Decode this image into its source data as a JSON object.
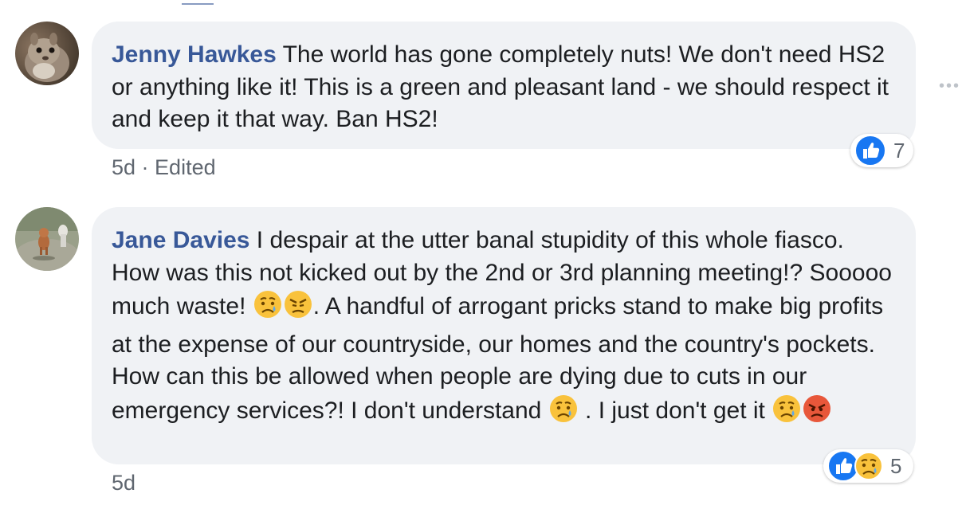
{
  "comments": [
    {
      "author": "Jenny Hawkes",
      "text": " The world has gone completely nuts! We don't need HS2 or anything like it! This is a green and pleasant land - we should respect it and keep it that way. Ban HS2!",
      "time": "5d",
      "separator": " · ",
      "edited": "Edited",
      "reaction_icons": [
        "like-icon"
      ],
      "reaction_count": "7",
      "avatar_icon": "squirrel-avatar"
    },
    {
      "author": "Jane Davies",
      "text_parts": [
        " I despair at the utter banal stupidity of this whole fiasco. How was this not kicked out by the 2nd or 3rd planning meeting!? Sooooo much waste! ",
        ". A handful of arrogant pricks stand to make big profits at the expense of our countryside, our homes and the country's pockets. How can this be allowed when people are dying due to cuts in our emergency services?! I don't understand ",
        " . I just don't get it "
      ],
      "emojis": [
        "sad-tear-emoji",
        "angry-emoji",
        "sad-tear-emoji",
        "sad-tear-emoji",
        "pouting-emoji"
      ],
      "time": "5d",
      "reaction_icons": [
        "like-icon",
        "sad-icon"
      ],
      "reaction_count": "5",
      "avatar_icon": "dog-photo-avatar"
    }
  ],
  "more_options": "•••",
  "colors": {
    "author": "#385898",
    "bubble": "#f0f2f5",
    "like": "#1877f2",
    "meta": "#606770"
  }
}
